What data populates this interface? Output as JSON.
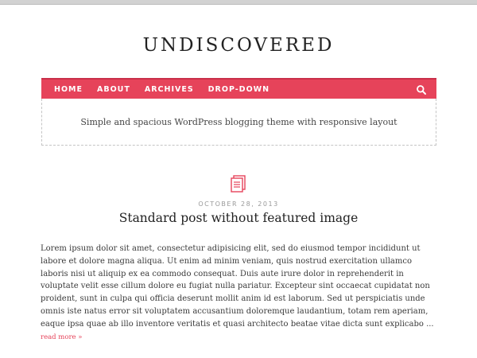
{
  "site": {
    "title": "UNDISCOVERED",
    "tagline": "Simple and spacious WordPress blogging theme with responsive layout"
  },
  "nav": {
    "items": [
      {
        "label": "HOME"
      },
      {
        "label": "ABOUT"
      },
      {
        "label": "ARCHIVES"
      },
      {
        "label": "DROP-DOWN"
      }
    ],
    "search_icon": "search-icon"
  },
  "post": {
    "format_icon": "document-icon",
    "date": "OCTOBER 28, 2013",
    "title": "Standard post without featured image",
    "excerpt": "Lorem ipsum dolor sit amet, consectetur adipisicing elit, sed do eiusmod tempor incididunt ut labore et dolore magna aliqua. Ut enim ad minim veniam, quis nostrud exercitation ullamco laboris nisi ut aliquip ex ea commodo consequat. Duis aute irure dolor in reprehenderit in voluptate velit esse cillum dolore eu fugiat nulla pariatur. Excepteur sint occaecat cupidatat non proident, sunt in culpa qui officia deserunt mollit anim id est laborum. Sed ut perspiciatis unde omnis iste natus error sit voluptatem accusantium doloremque laudantium, totam rem aperiam, eaque ipsa quae ab illo inventore veritatis et quasi architecto beatae vitae dicta sunt explicabo ...",
    "read_more": "read more »"
  },
  "colors": {
    "accent": "#e6435a",
    "accent_dark": "#c9304a"
  }
}
